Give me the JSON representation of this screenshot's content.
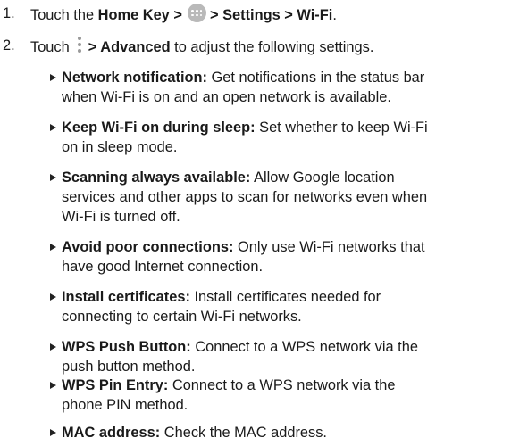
{
  "steps": [
    {
      "number": "1.",
      "touch": "Touch the",
      "home_key": "Home Key >",
      "apps_icon": "apps-circle-icon",
      "path": "> Settings > Wi-Fi",
      "period": "."
    },
    {
      "number": "2.",
      "touch": "Touch",
      "menu_icon": "vertical-dots-menu-icon",
      "advanced": "> Advanced",
      "rest": "to adjust the following settings."
    }
  ],
  "settings": [
    {
      "term": "Network notification:",
      "lines": [
        " Get notifications in the status bar",
        "when Wi-Fi is on and an open network is available."
      ]
    },
    {
      "term": "Keep Wi-Fi on during sleep:",
      "lines": [
        " Set whether to keep Wi-Fi",
        "on in sleep mode."
      ]
    },
    {
      "term": "Scanning always available:",
      "lines": [
        " Allow Google location",
        "services and other apps to scan for networks even when",
        "Wi-Fi is turned off."
      ]
    },
    {
      "term": "Avoid poor connections:",
      "lines": [
        " Only use Wi-Fi networks that",
        "have good Internet connection."
      ]
    },
    {
      "term": "Install certificates:",
      "lines": [
        " Install certificates needed for",
        "connecting to certain Wi-Fi networks."
      ]
    },
    {
      "term": "WPS Push Button:",
      "lines": [
        " Connect to a WPS network via the",
        "push button method."
      ]
    },
    {
      "term": "WPS Pin Entry:",
      "lines": [
        " Connect to a WPS network via the",
        "phone PIN method."
      ]
    },
    {
      "term": "MAC address:",
      "lines": [
        " Check the MAC address."
      ]
    }
  ]
}
